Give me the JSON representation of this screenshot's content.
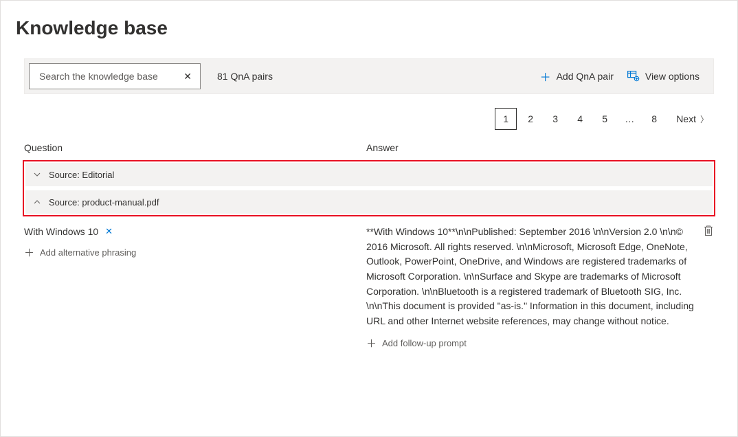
{
  "page": {
    "title": "Knowledge base"
  },
  "toolbar": {
    "search_placeholder": "Search the knowledge base",
    "pair_count_label": "81 QnA pairs",
    "add_pair_label": "Add QnA pair",
    "view_options_label": "View options"
  },
  "pagination": {
    "pages": [
      "1",
      "2",
      "3",
      "4",
      "5"
    ],
    "ellipsis": "…",
    "last_page": "8",
    "next_label": "Next",
    "current": "1"
  },
  "columns": {
    "question": "Question",
    "answer": "Answer"
  },
  "sources": {
    "collapsed": "Source: Editorial",
    "expanded": "Source: product-manual.pdf"
  },
  "qna": {
    "question_chip": "With Windows 10",
    "add_alt_label": "Add alternative phrasing",
    "answer": "**With Windows 10**\\n\\nPublished: September 2016 \\n\\nVersion 2.0 \\n\\n© 2016 Microsoft. All rights reserved. \\n\\nMicrosoft, Microsoft Edge, OneNote, Outlook, PowerPoint, OneDrive, and Windows are registered trademarks of Microsoft Corporation. \\n\\nSurface and Skype are trademarks of Microsoft Corporation. \\n\\nBluetooth is a registered trademark of Bluetooth SIG, Inc. \\n\\nThis document is provided \"as-is.\" Information in this document, including URL and other Internet website references, may change without notice.",
    "add_followup_label": "Add follow-up prompt"
  }
}
